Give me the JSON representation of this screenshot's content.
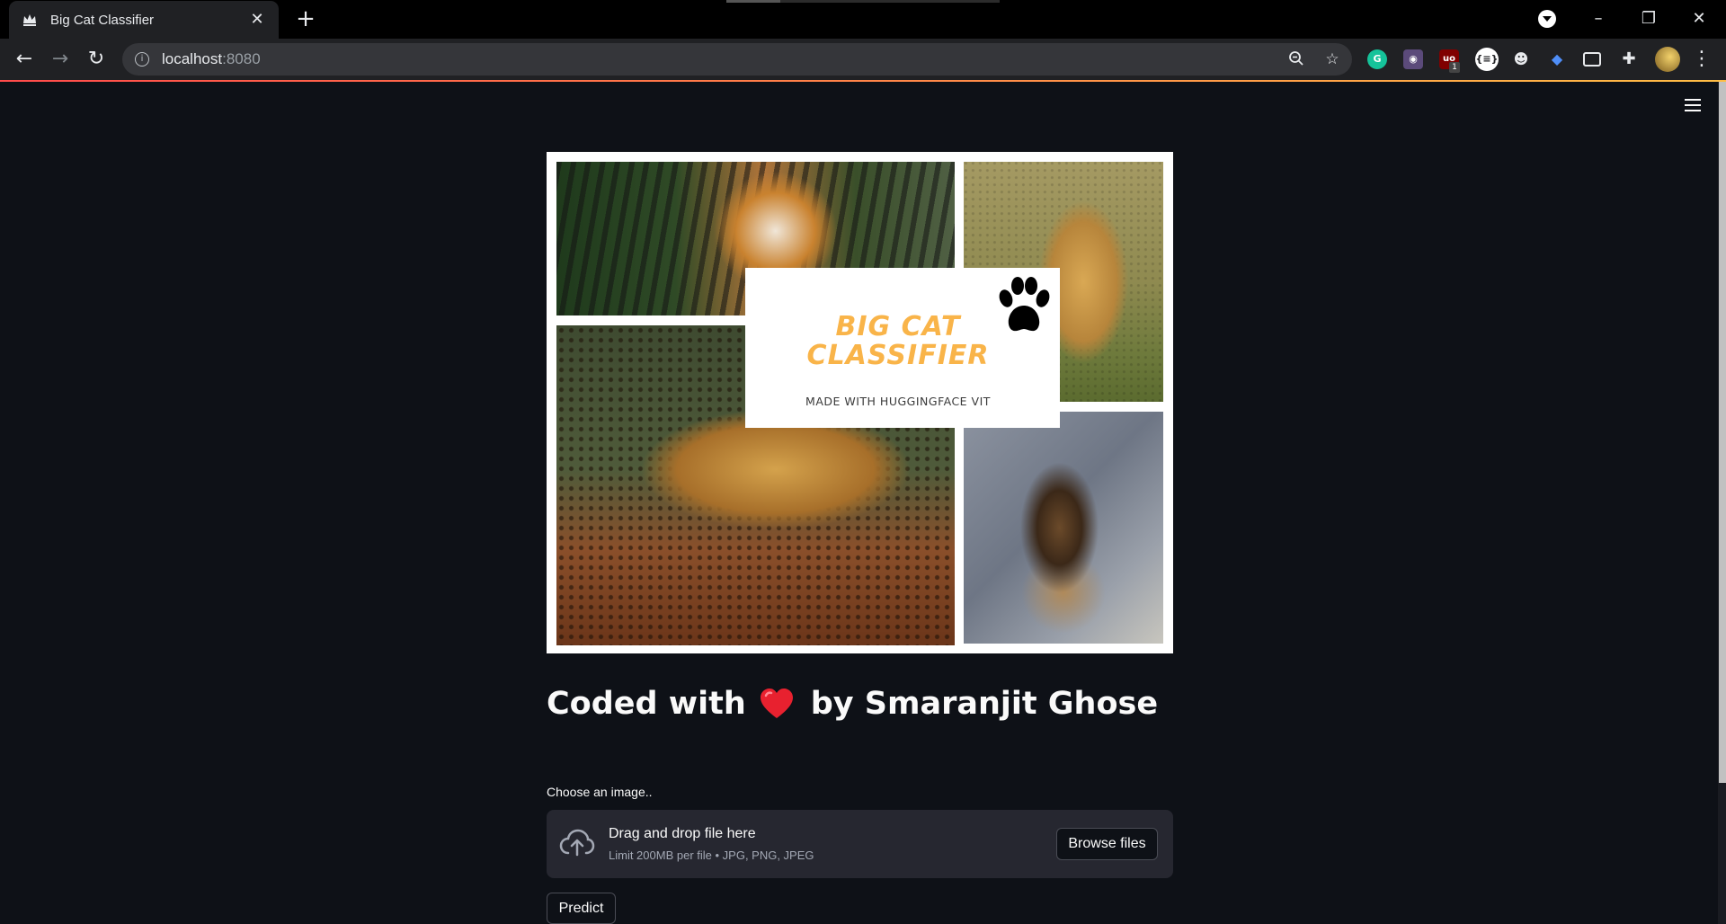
{
  "browser": {
    "tab_title": "Big Cat Classifier",
    "url_host": "localhost",
    "url_port": ":8080",
    "extension_badge": "1"
  },
  "banner": {
    "title": "BIG CAT CLASSIFIER",
    "subtitle": "MADE WITH HUGGINGFACE VIT",
    "photos": [
      "tiger",
      "cheetah",
      "jaguar",
      "lion"
    ]
  },
  "headline": {
    "prefix": "Coded with",
    "suffix": "by Smaranjit Ghose",
    "emoji_icon": "heart-icon"
  },
  "uploader": {
    "label": "Choose an image..",
    "drop_text": "Drag and drop file here",
    "limit_text": "Limit 200MB per file • JPG, PNG, JPEG",
    "browse_label": "Browse files"
  },
  "actions": {
    "predict_label": "Predict"
  },
  "colors": {
    "app_bg": "#0e1117",
    "dropzone_bg": "#262730",
    "title_orange": "#f9b449",
    "accent_red": "#ff4b4b",
    "accent_yellow": "#ffbd45"
  }
}
